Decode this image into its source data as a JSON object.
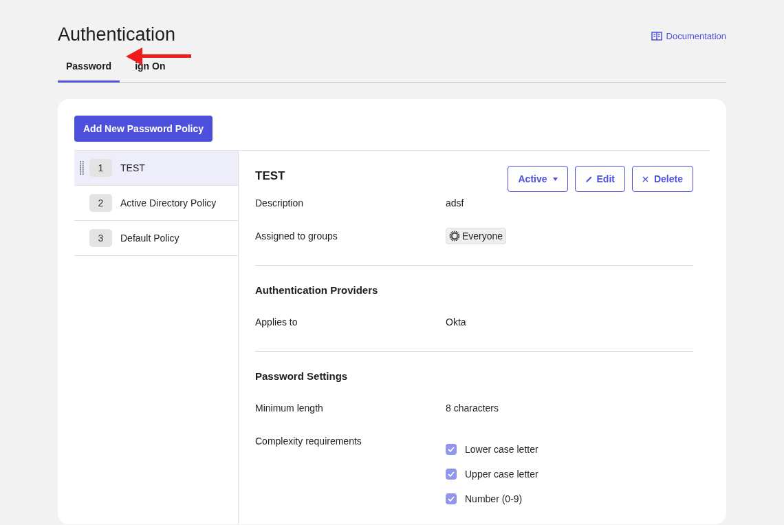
{
  "header": {
    "title": "Authentication",
    "doc_link": "Documentation"
  },
  "tabs": [
    {
      "label": "Password",
      "selected": true
    },
    {
      "label": "ign On",
      "selected": false
    }
  ],
  "annotation": {
    "kind": "arrow"
  },
  "add_button": "Add New Password Policy",
  "policies": [
    {
      "number": "1",
      "name": "TEST",
      "selected": true
    },
    {
      "number": "2",
      "name": "Active Directory Policy",
      "selected": false
    },
    {
      "number": "3",
      "name": "Default Policy",
      "selected": false
    }
  ],
  "detail": {
    "title": "TEST",
    "status_button": "Active",
    "edit_button": "Edit",
    "delete_button": "Delete",
    "fields": [
      {
        "label": "Description",
        "value": "adsf",
        "kind": "text"
      },
      {
        "label": "Assigned to groups",
        "value": "Everyone",
        "kind": "tag"
      }
    ],
    "sections": [
      {
        "title": "Authentication Providers",
        "fields": [
          {
            "label": "Applies to",
            "value": "Okta",
            "kind": "text"
          }
        ]
      },
      {
        "title": "Password Settings",
        "fields": [
          {
            "label": "Minimum length",
            "value": "8 characters",
            "kind": "text"
          },
          {
            "label": "Complexity requirements",
            "kind": "checklist",
            "items": [
              {
                "label": "Lower case letter",
                "checked": true
              },
              {
                "label": "Upper case letter",
                "checked": true
              },
              {
                "label": "Number (0-9)",
                "checked": true
              }
            ]
          }
        ]
      }
    ]
  }
}
